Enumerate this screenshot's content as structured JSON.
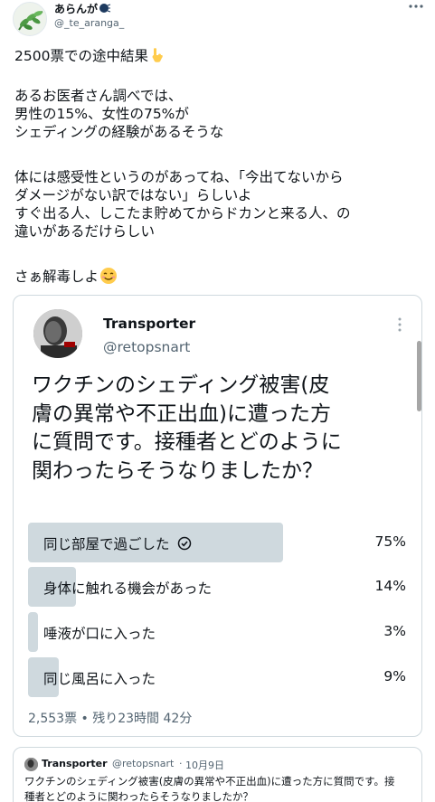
{
  "author": {
    "display_name": "あらんが",
    "handle": "@_te_aranga_",
    "avatar": "leaf-avatar",
    "badge_icon": "face-speaking-emoji"
  },
  "tweet": {
    "line1": "2500票での途中結果",
    "para2": "あるお医者さん調べでは、\n男性の15%、女性の75%が\nシェディングの経験があるそうな",
    "para3": "体には感受性というのがあってね、「今出てないから\nダメージがない訳ではない」らしいよ\nすぐ出る人、しこたま貯めてからドカンと来る人、の\n違いがあるだけらしい",
    "para4": "さぁ解毒しよ",
    "emoji_point": "backhand-index-pointing-down",
    "emoji_smile": "smiling-face-with-smiling-eyes"
  },
  "embed": {
    "name": "Transporter",
    "handle": "@retopsnart",
    "question": "ワクチンのシェディング被害(皮\n膚の異常や不正出血)に遭った方\nに質問です。接種者とどのように\n関わったらそうなりましたか？",
    "poll": {
      "options": [
        {
          "label": "同じ部屋で過ごした",
          "percent_text": "75%",
          "percent": 75,
          "winner": true
        },
        {
          "label": "身体に触れる機会があった",
          "percent_text": "14%",
          "percent": 14,
          "winner": false
        },
        {
          "label": "唾液が口に入った",
          "percent_text": "3%",
          "percent": 3,
          "winner": false
        },
        {
          "label": "同じ風呂に入った",
          "percent_text": "9%",
          "percent": 9,
          "winner": false
        }
      ],
      "meta": "2,553票 • 残り23時間 42分"
    }
  },
  "quote": {
    "name": "Transporter",
    "handle": "@retopsnart",
    "separator": "·",
    "date": "10月9日",
    "text": "ワクチンのシェディング被害(皮膚の異常や不正出血)に遭った方に質問です。接\n種者とどのように関わったらそうなりましたか？"
  },
  "colors": {
    "text": "#0f1419",
    "secondary": "#536471",
    "border": "#cfd9de",
    "poll_bar": "#cfd9de"
  }
}
